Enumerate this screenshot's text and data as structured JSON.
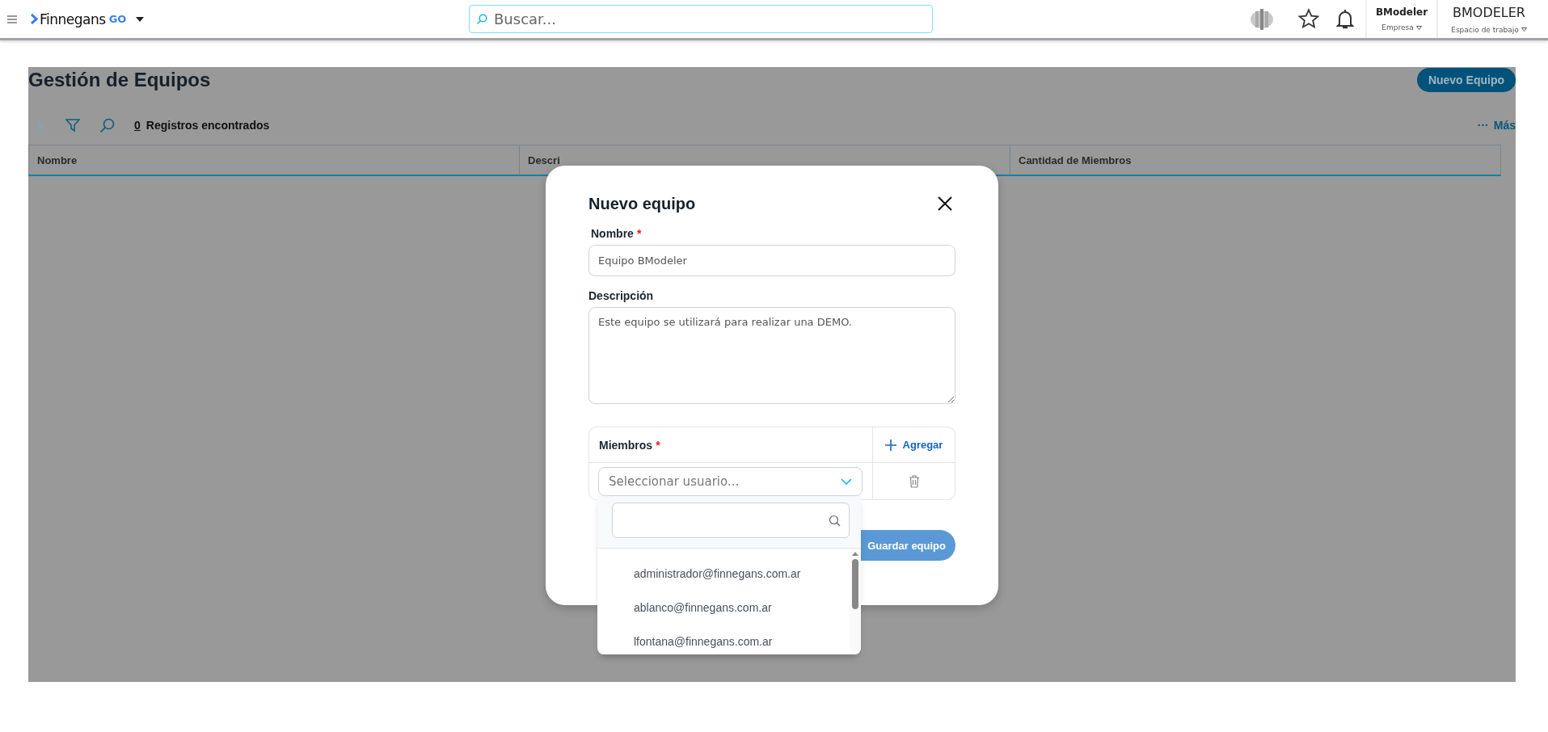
{
  "topbar": {
    "brand": {
      "name": "Finnegans",
      "suffix": "GO"
    },
    "search": {
      "placeholder": "Buscar..."
    },
    "company": {
      "name": "BModeler",
      "label": "Empresa"
    },
    "workspace": {
      "name": "BMODELER",
      "label": "Espacio de trabajo"
    }
  },
  "page": {
    "title": "Gestión de Equipos",
    "new_button": "Nuevo Equipo",
    "toolbar": {
      "download_disabled": true,
      "count": "0",
      "count_label": "Registros encontrados",
      "more_dots": "···",
      "more": "Más"
    },
    "table": {
      "columns": [
        "Nombre",
        "Descri",
        "Cantidad de Miembros"
      ]
    }
  },
  "dialog": {
    "title": "Nuevo equipo",
    "fields": [
      {
        "kind": "input",
        "label": "Nombre",
        "required_mark": "*",
        "value": "Equipo BModeler"
      },
      {
        "kind": "textarea",
        "label": "Descripción",
        "value": "Este equipo se utilizará para realizar una DEMO."
      }
    ],
    "members": {
      "label": "Miembros",
      "required_mark": "*",
      "add": "Agregar",
      "select_placeholder": "Seleccionar usuario...",
      "expanded": true,
      "options": [
        "administrador@finnegans.com.ar",
        "ablanco@finnegans.com.ar",
        "lfontana@finnegans.com.ar"
      ]
    },
    "save": {
      "label": "Guardar equipo",
      "disabled": true
    }
  }
}
